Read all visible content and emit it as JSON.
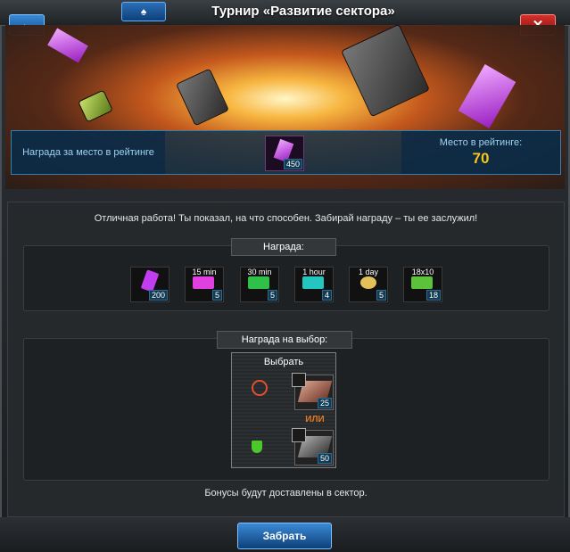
{
  "window": {
    "title": "Турнир «Развитие сектора»",
    "back_icon": "←",
    "close_icon": "✕",
    "tournament_icon": "♠"
  },
  "banner": {
    "place_reward_label": "Награда за место в рейтинге",
    "item_count": "450",
    "rating_label": "Место в рейтинге:",
    "rating_value": "70"
  },
  "content": {
    "message": "Отличная работа! Ты показал, на что способен. Забирай награду – ты ее заслужил!",
    "reward_label": "Награда:",
    "rewards": [
      {
        "tag": "",
        "count": "200",
        "color": "#c23cf0"
      },
      {
        "tag": "15 min",
        "count": "5",
        "color": "#e040e0"
      },
      {
        "tag": "30 min",
        "count": "5",
        "color": "#2fc04a"
      },
      {
        "tag": "1 hour",
        "count": "4",
        "color": "#23c7c0"
      },
      {
        "tag": "1 day",
        "count": "5",
        "color": "#e3c05a"
      },
      {
        "tag": "18x10",
        "count": "18",
        "color": "#5bc23a"
      }
    ],
    "choice_label": "Награда на выбор:",
    "choice_title": "Выбрать",
    "choice_option_1_count": "25",
    "choice_or": "ИЛИ",
    "choice_option_2_count": "50",
    "footer": "Бонусы будут доставлены в сектор."
  },
  "actions": {
    "take_label": "Забрать"
  }
}
